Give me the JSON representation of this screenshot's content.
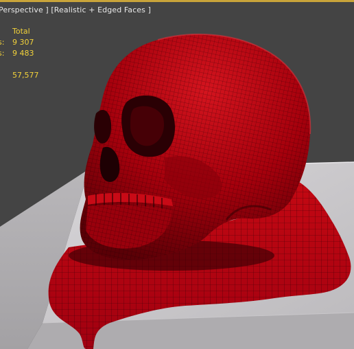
{
  "viewport": {
    "label": "Perspective ] [Realistic + Edged Faces ]",
    "label_prefix": "",
    "colors": {
      "background": "#444444",
      "border_accent": "#c9a43a",
      "stats_text": "#f2d23a",
      "mesh_red": "#b0000e",
      "pedestal": "#c8c6c8"
    }
  },
  "stats": {
    "header": "Total",
    "rows": [
      {
        "label": "s:",
        "value": "9 307"
      },
      {
        "label": "s:",
        "value": "9 483"
      },
      {
        "label": ":",
        "value": "57,577"
      }
    ]
  },
  "scene": {
    "object": "skull-mesh",
    "base_object": "pedestal-box",
    "fluid_object": "blood-pool"
  }
}
